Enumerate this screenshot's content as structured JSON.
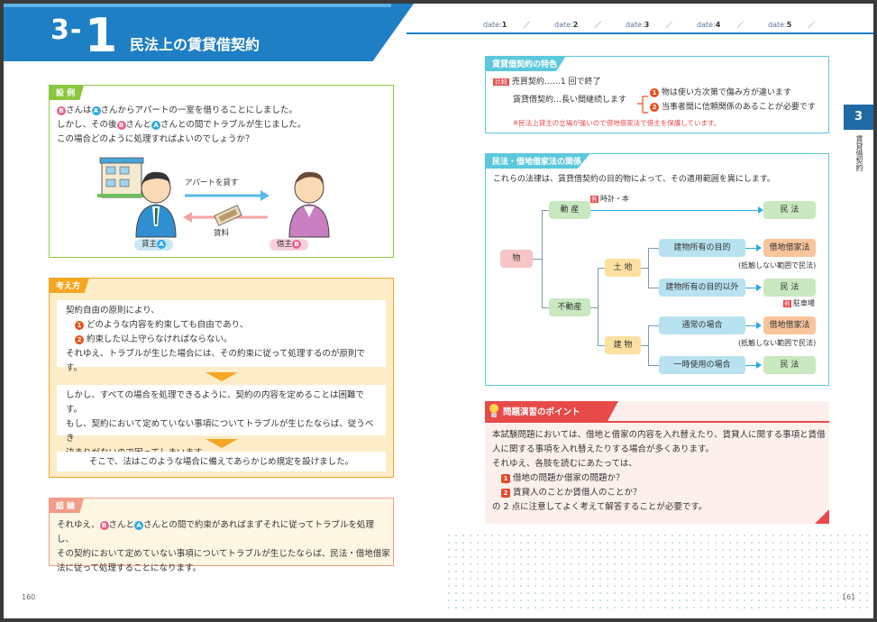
{
  "header": {
    "chapter_prefix": "3-",
    "chapter_num": "1",
    "title": "民法上の賃貸借契約",
    "dates": [
      {
        "label": "date:",
        "num": "1"
      },
      {
        "label": "date:",
        "num": "2"
      },
      {
        "label": "date:",
        "num": "3"
      },
      {
        "label": "date:",
        "num": "4"
      },
      {
        "label": "date:",
        "num": "5"
      }
    ],
    "date_sep": "／"
  },
  "example": {
    "tag": "設 例",
    "line1_a": "さんは",
    "line1_b": "さんからアパートの一室を借りることにしました。",
    "line2_a": "しかし、その後",
    "line2_b": "さんと",
    "line2_c": "さんとの間でトラブルが生じました。",
    "line3": "この場合どのように処理すればよいのでしょうか？",
    "arrow_top": "アパートを貸す",
    "arrow_bottom": "賃料",
    "landlord": "貸主",
    "tenant": "借主",
    "circle_b": "B",
    "circle_a": "A"
  },
  "thinking": {
    "tag": "考え方",
    "p1_l1": "契約自由の原則により、",
    "p1_l2": "どのような内容を約束しても自由であり、",
    "p1_l3": "約束した以上守らなければならない。",
    "p1_l4": "それゆえ、トラブルが生じた場合には、その約束に従って処理するのが原則です。",
    "p2_l1": "しかし、すべての場合を処理できるように、契約の内容を定めることは困難です。",
    "p2_l2": "もし、契約において定めていない事項についてトラブルが生じたならば、従うべき",
    "p2_l3": "決まりがないので困ってしまいます。",
    "p3": "そこで、法はこのような場合に備えてあらかじめ規定を設けました。",
    "num1": "1",
    "num2": "2"
  },
  "conclusion": {
    "tag": "結 論",
    "l1_a": "それゆえ、",
    "l1_b": "さんと",
    "l1_c": "さんとの間で約束があればまずそれに従ってトラブルを処理し、",
    "l2": "その契約において定めていない事項についてトラブルが生じたならば、民法・借地借家",
    "l3": "法に従って処理することになります。"
  },
  "features": {
    "tag": "賃貸借契約の特色",
    "hikaku": "比較",
    "sale": "売買契約……1 回で終了",
    "lease": "賃貸借契約…長い間継続します",
    "b1": "物は使い方次第で傷み方が違います",
    "b2": "当事者間に信頼関係のあることが必要です",
    "note": "※民法上貸主の立場が強いので借地借家法で借主を保護しています。",
    "n1": "1",
    "n2": "2"
  },
  "relation": {
    "tag": "民法・借地借家法の関係",
    "intro": "これらの法律は、賃貸借契約の目的物によって、その適用範囲を異にします。",
    "mono": "物",
    "dosan": "動 産",
    "fudosan": "不動産",
    "tochi": "土 地",
    "tatemono": "建 物",
    "ex_mark": "例",
    "ex_dosan": "時計・本",
    "ex_park": "駐車場",
    "b_own": "建物所有の目的",
    "b_notown": "建物所有の目的以外",
    "b_normal": "通常の場合",
    "b_temp": "一時使用の場合",
    "minpo": "民 法",
    "shakuchi": "借地借家法",
    "note_conflict": "(抵触しない範囲で民法)"
  },
  "points": {
    "tag": "問題演習のポイント",
    "l1": "本試験問題においては、借地と借家の内容を入れ替えたり、賃貸人に関する事項と賃借",
    "l2": "人に関する事項を入れ替えたりする場合が多くあります。",
    "l3": "それゆえ、各肢を読むにあたっては、",
    "q1": "借地の問題か借家の問題か？",
    "q2": "賃貸人のことか賃借人のことか？",
    "l4": "の 2 点に注意してよく考えて解答することが必要です。",
    "n1": "1",
    "n2": "2"
  },
  "side": {
    "chapter": "3",
    "label": "賃貸借契約"
  },
  "pages": {
    "left": "160",
    "right": "161"
  },
  "colors": {
    "brand_blue": "#1f7fc4",
    "green": "#8cc63f",
    "orange": "#f5a623",
    "cyan": "#5bc8dc",
    "red": "#e84a4a"
  }
}
